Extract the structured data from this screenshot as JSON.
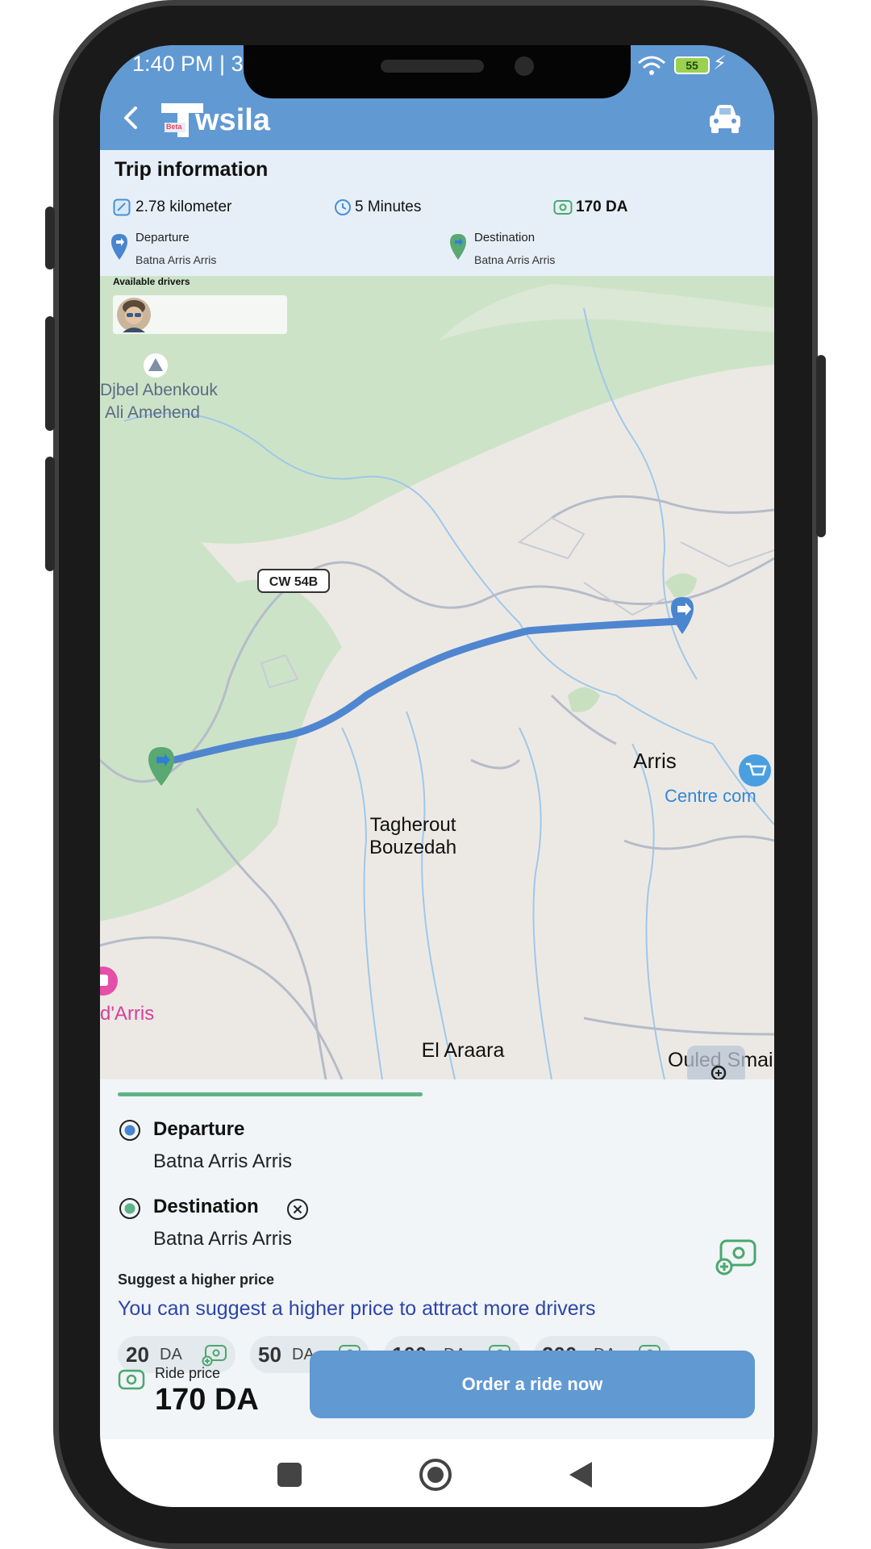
{
  "status_bar": {
    "time": "1:40 PM | 3",
    "battery": "55"
  },
  "header": {
    "app_name": "wsila",
    "logo_badge": "Beta"
  },
  "trip_info": {
    "title": "Trip information",
    "distance": "2.78 kilometer",
    "duration": "5 Minutes",
    "price": "170 DA",
    "departure_label": "Departure",
    "departure_value": "Batna Arris Arris",
    "destination_label": "Destination",
    "destination_value": "Batna Arris Arris",
    "available_drivers_label": "Available drivers"
  },
  "map": {
    "labels": {
      "mountain": "Djbel Abenkouk Ali Amehend",
      "road": "CW 54B",
      "town1": "Tagherout Bouzedah",
      "town2": "Arris",
      "poi": "Centre com",
      "place_left": "d'Arris",
      "town3": "El Araara",
      "town4": "Ouled Smail"
    }
  },
  "booking": {
    "departure_title": "Departure",
    "departure_value": "Batna Arris Arris",
    "destination_title": "Destination",
    "destination_value": "Batna Arris Arris",
    "suggest_title": "Suggest a higher price",
    "suggest_text": "You can suggest a higher price to attract more drivers",
    "price_options": [
      {
        "amount": "20",
        "currency": "DA"
      },
      {
        "amount": "50",
        "currency": "DA"
      },
      {
        "amount": "100",
        "currency": "DA"
      },
      {
        "amount": "200",
        "currency": "DA"
      }
    ],
    "ride_price_label": "Ride price",
    "ride_price_value": "170 DA",
    "order_button": "Order a ride now"
  },
  "colors": {
    "header_blue": "#6199d3",
    "route_blue": "#4f86cf",
    "accent_green": "#5fb388",
    "link_blue": "#2d45a8"
  }
}
